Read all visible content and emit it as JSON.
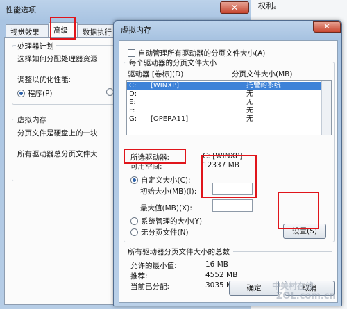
{
  "back_window": {
    "title": "性能选项",
    "close_glyph": "✕",
    "tabs": [
      "视觉效果",
      "高级",
      "数据执行"
    ],
    "processor_group": {
      "label": "处理器计划",
      "desc": "选择如何分配处理器资源",
      "optimize_label": "调整以优化性能:",
      "option_programs": "程序(P)"
    },
    "vm_group": {
      "label": "虚拟内存",
      "line1": "分页文件是硬盘上的一块",
      "line2": "所有驱动器总分页文件大"
    }
  },
  "right_background": {
    "text": "权利。"
  },
  "dialog": {
    "title": "虚拟内存",
    "close_glyph": "✕",
    "auto_manage_label": "自动管理所有驱动器的分页文件大小(A)",
    "per_drive_label": "每个驱动器的分页文件大小",
    "columns": {
      "drive": "驱动器 [卷标](D)",
      "size": "分页文件大小(MB)"
    },
    "drives": [
      {
        "drive": "C:",
        "label": "[WINXP]",
        "size": "托管的系统",
        "selected": true
      },
      {
        "drive": "D:",
        "label": "",
        "size": "无",
        "selected": false
      },
      {
        "drive": "E:",
        "label": "",
        "size": "无",
        "selected": false
      },
      {
        "drive": "F:",
        "label": "",
        "size": "无",
        "selected": false
      },
      {
        "drive": "G:",
        "label": "[OPERA11]",
        "size": "无",
        "selected": false
      }
    ],
    "selected_drive_label": "所选驱动器:",
    "selected_drive_value": "C:  [WINXP]",
    "free_space_label": "可用空间:",
    "free_space_value": "12337 MB",
    "custom_size_label": "自定义大小(C):",
    "initial_size_label": "初始大小(MB)(I):",
    "initial_size_value": "",
    "max_size_label": "最大值(MB)(X):",
    "max_size_value": "",
    "system_managed_label": "系统管理的大小(Y)",
    "no_paging_label": "无分页文件(N)",
    "set_button": "设置(S)",
    "total_group_label": "所有驱动器分页文件大小的总数",
    "min_allowed_label": "允许的最小值:",
    "min_allowed_value": "16 MB",
    "recommended_label": "推荐:",
    "recommended_value": "4552 MB",
    "current_label": "当前已分配:",
    "current_value": "3035 MB",
    "ok_button": "确定",
    "cancel_button": "取消"
  },
  "watermark": {
    "line1": "中关村在线",
    "line2": "ZOL.com.cn"
  },
  "colors": {
    "highlight": "#e0151b",
    "selection": "#3d82d8"
  }
}
